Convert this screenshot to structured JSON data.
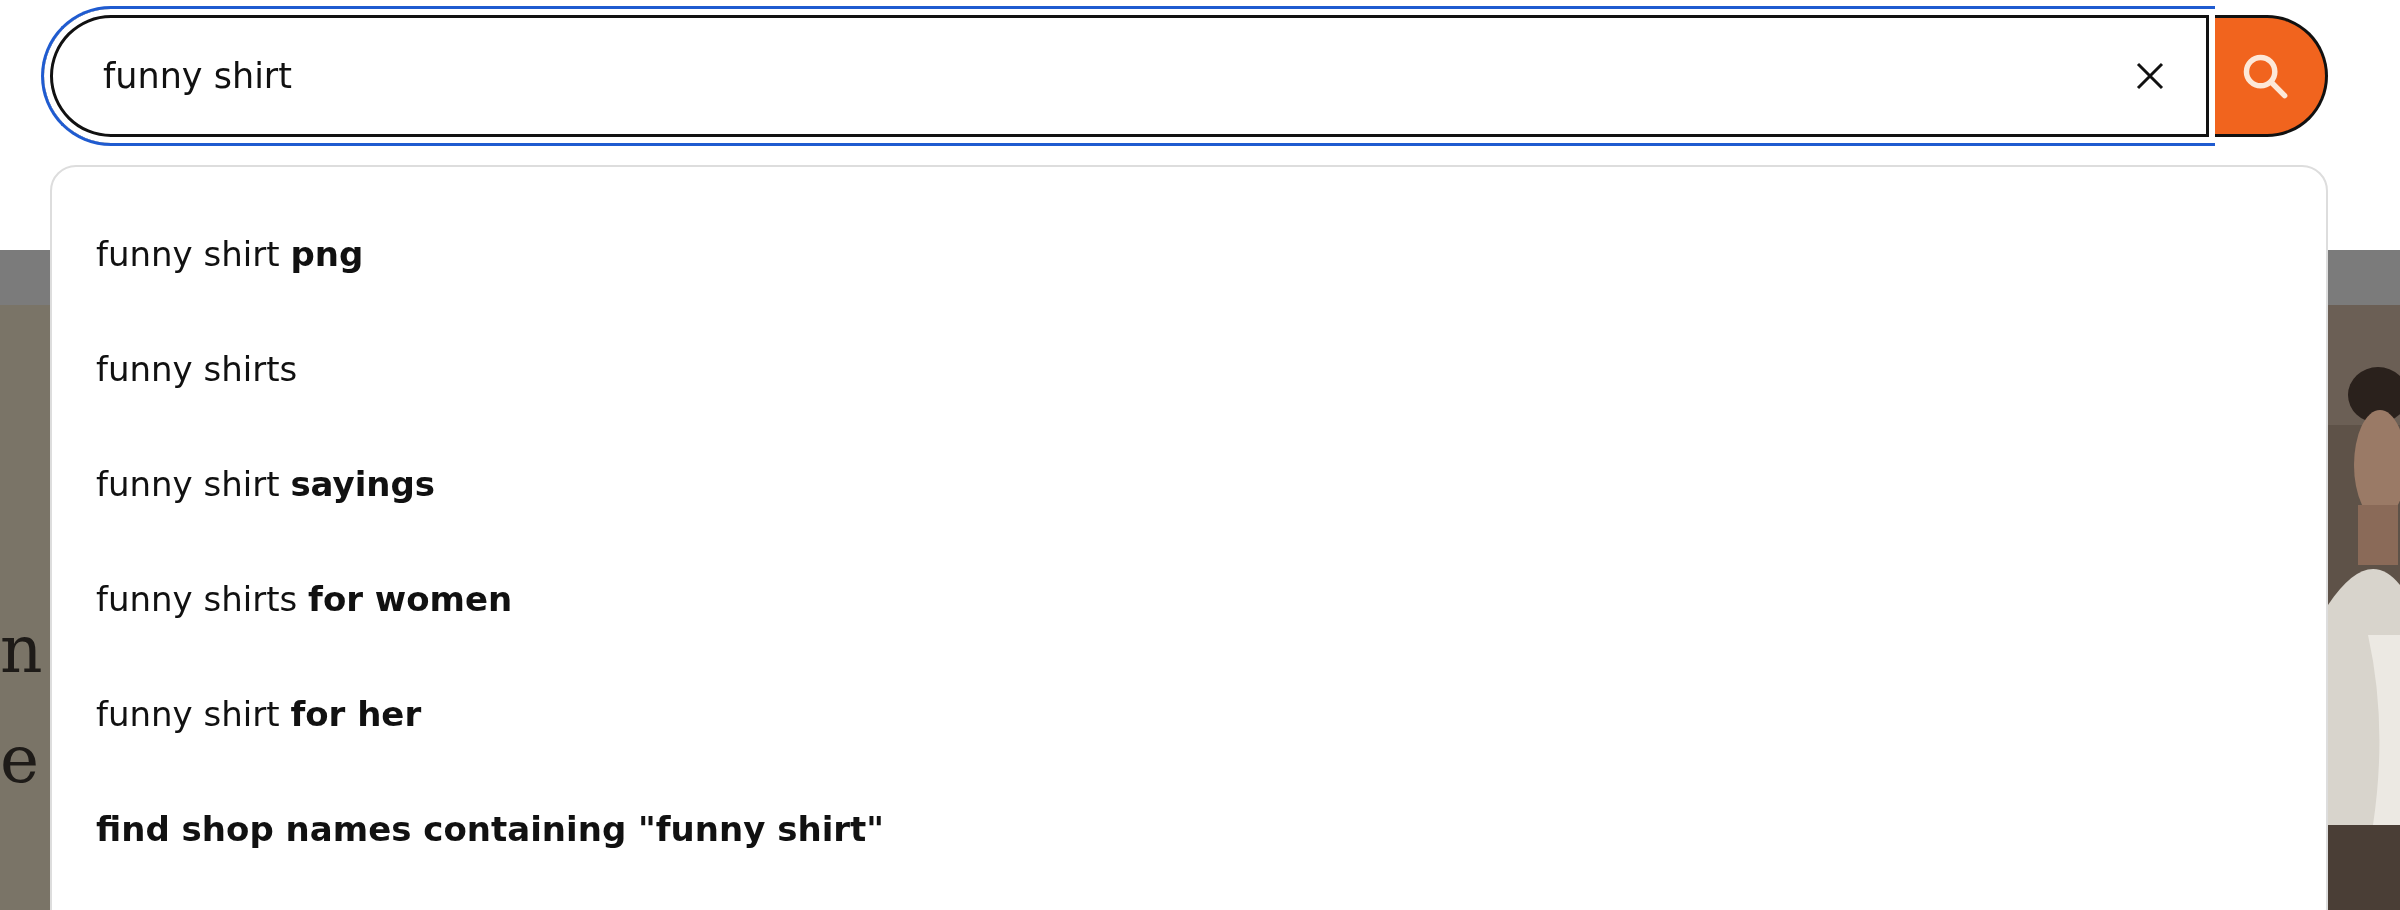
{
  "search": {
    "value": "funny shirt",
    "focused": true
  },
  "suggestions": [
    {
      "kind": "query",
      "text": "funny shirt **png**"
    },
    {
      "kind": "query",
      "text": "funny shirts"
    },
    {
      "kind": "query",
      "text": "funny shirt **sayings**"
    },
    {
      "kind": "query",
      "text": "funny shirts **for women**"
    },
    {
      "kind": "query",
      "text": "funny shirt **for her**"
    },
    {
      "kind": "shop",
      "text": "find shop names containing \"funny shirt\""
    }
  ],
  "hero": {
    "heading_lines": [
      "n",
      "e"
    ],
    "kind": "picture"
  }
}
